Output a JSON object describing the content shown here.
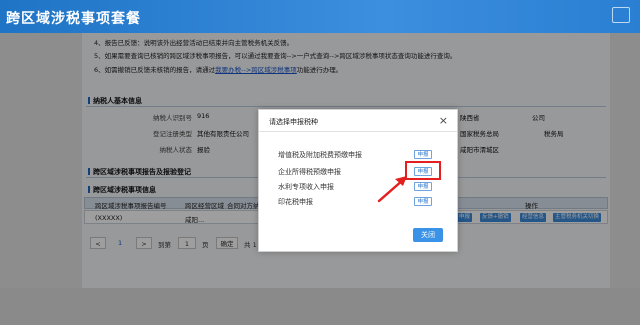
{
  "window": {
    "title": "跨区域涉税事项套餐"
  },
  "notes": [
    {
      "text": "4、报告已反馈：说明该外出经营活动已结束并向主管税务机关反馈。"
    },
    {
      "text": "5、如果需要查询已核销的跨区域涉税事项报告，可以通过我要查询-->一户式查询-->跨区域涉税事项状态查询功能进行查询。"
    },
    {
      "prefix": "6、如需撤销已反馈未核销的报告，请通过",
      "link": "我要办税-->跨区域涉税事项",
      "suffix": "功能进行办理。"
    }
  ],
  "taxpayer": {
    "section_title": "纳税人基本信息",
    "fields": [
      {
        "label": "纳税人识别号",
        "value": "916"
      },
      {
        "label": "登记注册类型",
        "value": "其他有限责任公司"
      },
      {
        "label": "纳税人状态",
        "value": "报验"
      }
    ],
    "right_values": [
      "陕西省",
      "公司",
      "国家税务总局",
      "税务局",
      "咸阳市渭城区"
    ]
  },
  "cross_section": {
    "section_title": "跨区域涉税事项报告及报验登记",
    "sub_title": "跨区域涉税事项信息",
    "columns": [
      "跨区域涉税事项报告编号",
      "跨区经营区域",
      "合同对方纳",
      "操作"
    ],
    "row": {
      "cells": [
        "(XXXXX)",
        "咸阳..."
      ],
      "buttons": [
        "申报",
        "反馈+撤销",
        "经营信息",
        "主管税务机关切换"
      ]
    }
  },
  "pager": {
    "first": "<",
    "current": "1",
    "next": ">",
    "goto_prefix": "到第",
    "page_value": "1",
    "page_suffix": "页",
    "confirm": "确定",
    "total": "共 1"
  },
  "modal": {
    "title": "请选择申报税种",
    "close": "×",
    "options": [
      {
        "label": "增值税及附加税费预缴申报",
        "button": "申报"
      },
      {
        "label": "企业所得税预缴申报",
        "button": "申报"
      },
      {
        "label": "水利专项收入申报",
        "button": "申报"
      },
      {
        "label": "印花税申报",
        "button": "申报"
      }
    ],
    "confirm": "关闭"
  },
  "colors": {
    "titlebar": "#2a7fd3",
    "accent": "#3a93e6",
    "highlight": "#e31f1f"
  }
}
